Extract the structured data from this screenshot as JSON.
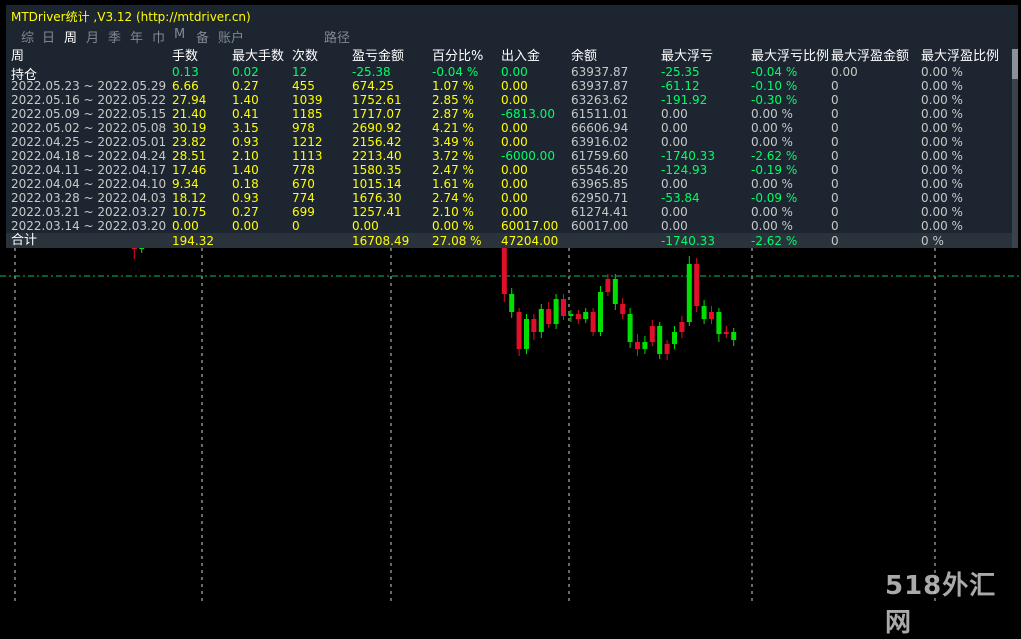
{
  "window": {
    "title": "MTDriver统计 ,V3.12 (http://mtdriver.cn)"
  },
  "tabs": [
    {
      "label": "综",
      "active": false
    },
    {
      "label": "日",
      "active": false
    },
    {
      "label": "周",
      "active": true
    },
    {
      "label": "月",
      "active": false
    },
    {
      "label": "季",
      "active": false
    },
    {
      "label": "年",
      "active": false
    },
    {
      "label": "巾",
      "active": false
    },
    {
      "label": "M",
      "active": false
    },
    {
      "label": "备",
      "active": false
    },
    {
      "label": "账户",
      "active": false
    },
    {
      "label": "路径",
      "active": false
    }
  ],
  "table": {
    "headers": [
      "周",
      "手数",
      "最大手数",
      "次数",
      "盈亏金额",
      "百分比%",
      "出入金",
      "余额",
      "最大浮亏",
      "最大浮亏比例",
      "最大浮盈金额",
      "最大浮盈比例"
    ],
    "position_label": "持仓",
    "position_row": [
      "",
      "0.13",
      "0.02",
      "12",
      "-25.38",
      "-0.04 %",
      "0.00",
      "63937.87",
      "-25.35",
      "-0.04 %",
      "0.00",
      "0.00 %"
    ],
    "rows": [
      [
        "2022.05.23 ~ 2022.05.29",
        "6.66",
        "0.27",
        "455",
        "674.25",
        "1.07 %",
        "0.00",
        "63937.87",
        "-61.12",
        "-0.10 %",
        "0",
        "0.00 %"
      ],
      [
        "2022.05.16 ~ 2022.05.22",
        "27.94",
        "1.40",
        "1039",
        "1752.61",
        "2.85 %",
        "0.00",
        "63263.62",
        "-191.92",
        "-0.30 %",
        "0",
        "0.00 %"
      ],
      [
        "2022.05.09 ~ 2022.05.15",
        "21.40",
        "0.41",
        "1185",
        "1717.07",
        "2.87 %",
        "-6813.00",
        "61511.01",
        "0.00",
        "0.00 %",
        "0",
        "0.00 %"
      ],
      [
        "2022.05.02 ~ 2022.05.08",
        "30.19",
        "3.15",
        "978",
        "2690.92",
        "4.21 %",
        "0.00",
        "66606.94",
        "0.00",
        "0.00 %",
        "0",
        "0.00 %"
      ],
      [
        "2022.04.25 ~ 2022.05.01",
        "23.82",
        "0.93",
        "1212",
        "2156.42",
        "3.49 %",
        "0.00",
        "63916.02",
        "0.00",
        "0.00 %",
        "0",
        "0.00 %"
      ],
      [
        "2022.04.18 ~ 2022.04.24",
        "28.51",
        "2.10",
        "1113",
        "2213.40",
        "3.72 %",
        "-6000.00",
        "61759.60",
        "-1740.33",
        "-2.62 %",
        "0",
        "0.00 %"
      ],
      [
        "2022.04.11 ~ 2022.04.17",
        "17.46",
        "1.40",
        "778",
        "1580.35",
        "2.47 %",
        "0.00",
        "65546.20",
        "-124.93",
        "-0.19 %",
        "0",
        "0.00 %"
      ],
      [
        "2022.04.04 ~ 2022.04.10",
        "9.34",
        "0.18",
        "670",
        "1015.14",
        "1.61 %",
        "0.00",
        "63965.85",
        "0.00",
        "0.00 %",
        "0",
        "0.00 %"
      ],
      [
        "2022.03.28 ~ 2022.04.03",
        "18.12",
        "0.93",
        "774",
        "1676.30",
        "2.74 %",
        "0.00",
        "62950.71",
        "-53.84",
        "-0.09 %",
        "0",
        "0.00 %"
      ],
      [
        "2022.03.21 ~ 2022.03.27",
        "10.75",
        "0.27",
        "699",
        "1257.41",
        "2.10 %",
        "0.00",
        "61274.41",
        "0.00",
        "0.00 %",
        "0",
        "0.00 %"
      ],
      [
        "2022.03.14 ~ 2022.03.20",
        "0.00",
        "0.00",
        "0",
        "0.00",
        "0.00 %",
        "60017.00",
        "60017.00",
        "0.00",
        "0.00 %",
        "0",
        "0.00 %"
      ]
    ],
    "total_label": "合计",
    "total_row": [
      "",
      "194.32",
      "",
      "",
      "16708.49",
      "27.08 %",
      "47204.00",
      "",
      "-1740.33",
      "-2.62 %",
      "0",
      "0 %"
    ]
  },
  "colors": {
    "panel_bg": "#1c2530",
    "white": "#ffffff",
    "yellow": "#ffff00",
    "green": "#00ff66",
    "gray": "#c8c8c8",
    "bull": "#00e000",
    "bear": "#e0102a"
  },
  "watermark": "518外汇网",
  "chart": {
    "candles": [
      [
        1,
        432,
        440,
        450,
        426
      ],
      [
        0,
        440,
        424,
        444,
        418
      ],
      [
        1,
        424,
        436,
        440,
        418
      ],
      [
        0,
        436,
        429,
        438,
        425
      ],
      [
        1,
        429,
        437,
        448,
        424
      ],
      [
        0,
        437,
        430,
        441,
        426
      ],
      [
        1,
        430,
        434,
        437,
        424
      ],
      [
        0,
        434,
        428,
        439,
        423
      ],
      [
        1,
        428,
        452,
        458,
        424
      ],
      [
        0,
        452,
        434,
        456,
        430
      ],
      [
        1,
        434,
        440,
        445,
        432
      ],
      [
        0,
        440,
        408,
        444,
        402
      ],
      [
        1,
        408,
        414,
        419,
        402
      ],
      [
        1,
        414,
        426,
        430,
        410
      ],
      [
        0,
        426,
        410,
        430,
        405
      ],
      [
        1,
        410,
        420,
        425,
        406
      ],
      [
        0,
        420,
        385,
        424,
        380
      ],
      [
        0,
        385,
        355,
        392,
        345
      ],
      [
        1,
        355,
        370,
        374,
        351
      ],
      [
        1,
        370,
        452,
        456,
        366
      ],
      [
        0,
        452,
        430,
        456,
        425
      ],
      [
        0,
        430,
        460,
        465,
        426
      ],
      [
        1,
        460,
        472,
        480,
        456
      ],
      [
        0,
        472,
        488,
        492,
        468
      ],
      [
        1,
        488,
        496,
        506,
        484
      ],
      [
        1,
        496,
        518,
        522,
        492
      ],
      [
        0,
        518,
        505,
        522,
        500
      ],
      [
        1,
        505,
        536,
        540,
        500
      ],
      [
        0,
        536,
        522,
        540,
        518
      ],
      [
        1,
        522,
        532,
        538,
        518
      ],
      [
        0,
        532,
        548,
        552,
        528
      ],
      [
        1,
        548,
        558,
        560,
        544
      ],
      [
        1,
        558,
        568,
        572,
        552
      ],
      [
        0,
        568,
        585,
        590,
        564
      ],
      [
        1,
        585,
        578,
        590,
        572
      ],
      [
        0,
        578,
        565,
        582,
        560
      ],
      [
        1,
        565,
        575,
        578,
        560
      ],
      [
        0,
        575,
        555,
        580,
        550
      ],
      [
        1,
        555,
        560,
        566,
        548
      ],
      [
        0,
        560,
        540,
        564,
        532
      ],
      [
        1,
        540,
        528,
        545,
        522
      ],
      [
        0,
        528,
        548,
        552,
        522
      ],
      [
        1,
        548,
        580,
        586,
        542
      ],
      [
        0,
        580,
        550,
        584,
        540
      ],
      [
        1,
        550,
        478,
        555,
        472
      ],
      [
        0,
        478,
        470,
        482,
        452
      ],
      [
        1,
        470,
        490,
        496,
        466
      ],
      [
        0,
        490,
        502,
        508,
        486
      ],
      [
        1,
        502,
        512,
        520,
        498
      ],
      [
        0,
        512,
        520,
        524,
        508
      ],
      [
        1,
        520,
        512,
        524,
        505
      ],
      [
        0,
        512,
        520,
        526,
        508
      ],
      [
        1,
        520,
        512,
        524,
        506
      ],
      [
        0,
        512,
        525,
        530,
        508
      ],
      [
        1,
        525,
        536,
        540,
        520
      ],
      [
        0,
        536,
        520,
        540,
        516
      ],
      [
        1,
        520,
        528,
        534,
        516
      ],
      [
        0,
        528,
        532,
        536,
        524
      ],
      [
        1,
        532,
        508,
        536,
        502
      ],
      [
        0,
        508,
        520,
        526,
        503
      ],
      [
        1,
        520,
        536,
        540,
        514
      ],
      [
        0,
        536,
        542,
        546,
        530
      ],
      [
        1,
        542,
        525,
        546,
        518
      ],
      [
        0,
        525,
        470,
        528,
        458
      ],
      [
        1,
        470,
        455,
        476,
        450
      ],
      [
        0,
        455,
        410,
        460,
        400
      ],
      [
        1,
        410,
        395,
        415,
        390
      ],
      [
        0,
        395,
        310,
        400,
        302
      ],
      [
        1,
        310,
        292,
        316,
        286
      ],
      [
        0,
        292,
        255,
        296,
        248
      ],
      [
        1,
        255,
        285,
        290,
        250
      ],
      [
        0,
        285,
        272,
        290,
        264
      ],
      [
        1,
        272,
        295,
        300,
        266
      ],
      [
        0,
        295,
        280,
        302,
        276
      ],
      [
        1,
        280,
        305,
        310,
        275
      ],
      [
        0,
        305,
        288,
        310,
        284
      ],
      [
        1,
        288,
        290,
        294,
        282
      ],
      [
        0,
        290,
        285,
        294,
        280
      ],
      [
        1,
        285,
        292,
        296,
        281
      ],
      [
        0,
        292,
        272,
        296,
        268
      ],
      [
        1,
        272,
        312,
        318,
        268
      ],
      [
        0,
        312,
        325,
        330,
        308
      ],
      [
        1,
        325,
        300,
        330,
        294
      ],
      [
        0,
        300,
        290,
        306,
        285
      ],
      [
        1,
        290,
        262,
        296,
        256
      ],
      [
        0,
        262,
        255,
        270,
        248
      ],
      [
        1,
        255,
        262,
        268,
        250
      ],
      [
        0,
        262,
        278,
        284,
        258
      ],
      [
        1,
        278,
        250,
        282,
        245
      ],
      [
        0,
        250,
        260,
        264,
        244
      ],
      [
        1,
        260,
        272,
        278,
        255
      ],
      [
        0,
        272,
        282,
        288,
        266
      ],
      [
        1,
        282,
        340,
        348,
        278
      ],
      [
        0,
        340,
        298,
        346,
        292
      ],
      [
        1,
        298,
        285,
        304,
        280
      ],
      [
        0,
        285,
        292,
        298,
        280
      ],
      [
        1,
        292,
        270,
        296,
        262
      ],
      [
        0,
        270,
        272,
        278,
        266
      ],
      [
        1,
        272,
        264,
        276,
        258
      ]
    ]
  }
}
